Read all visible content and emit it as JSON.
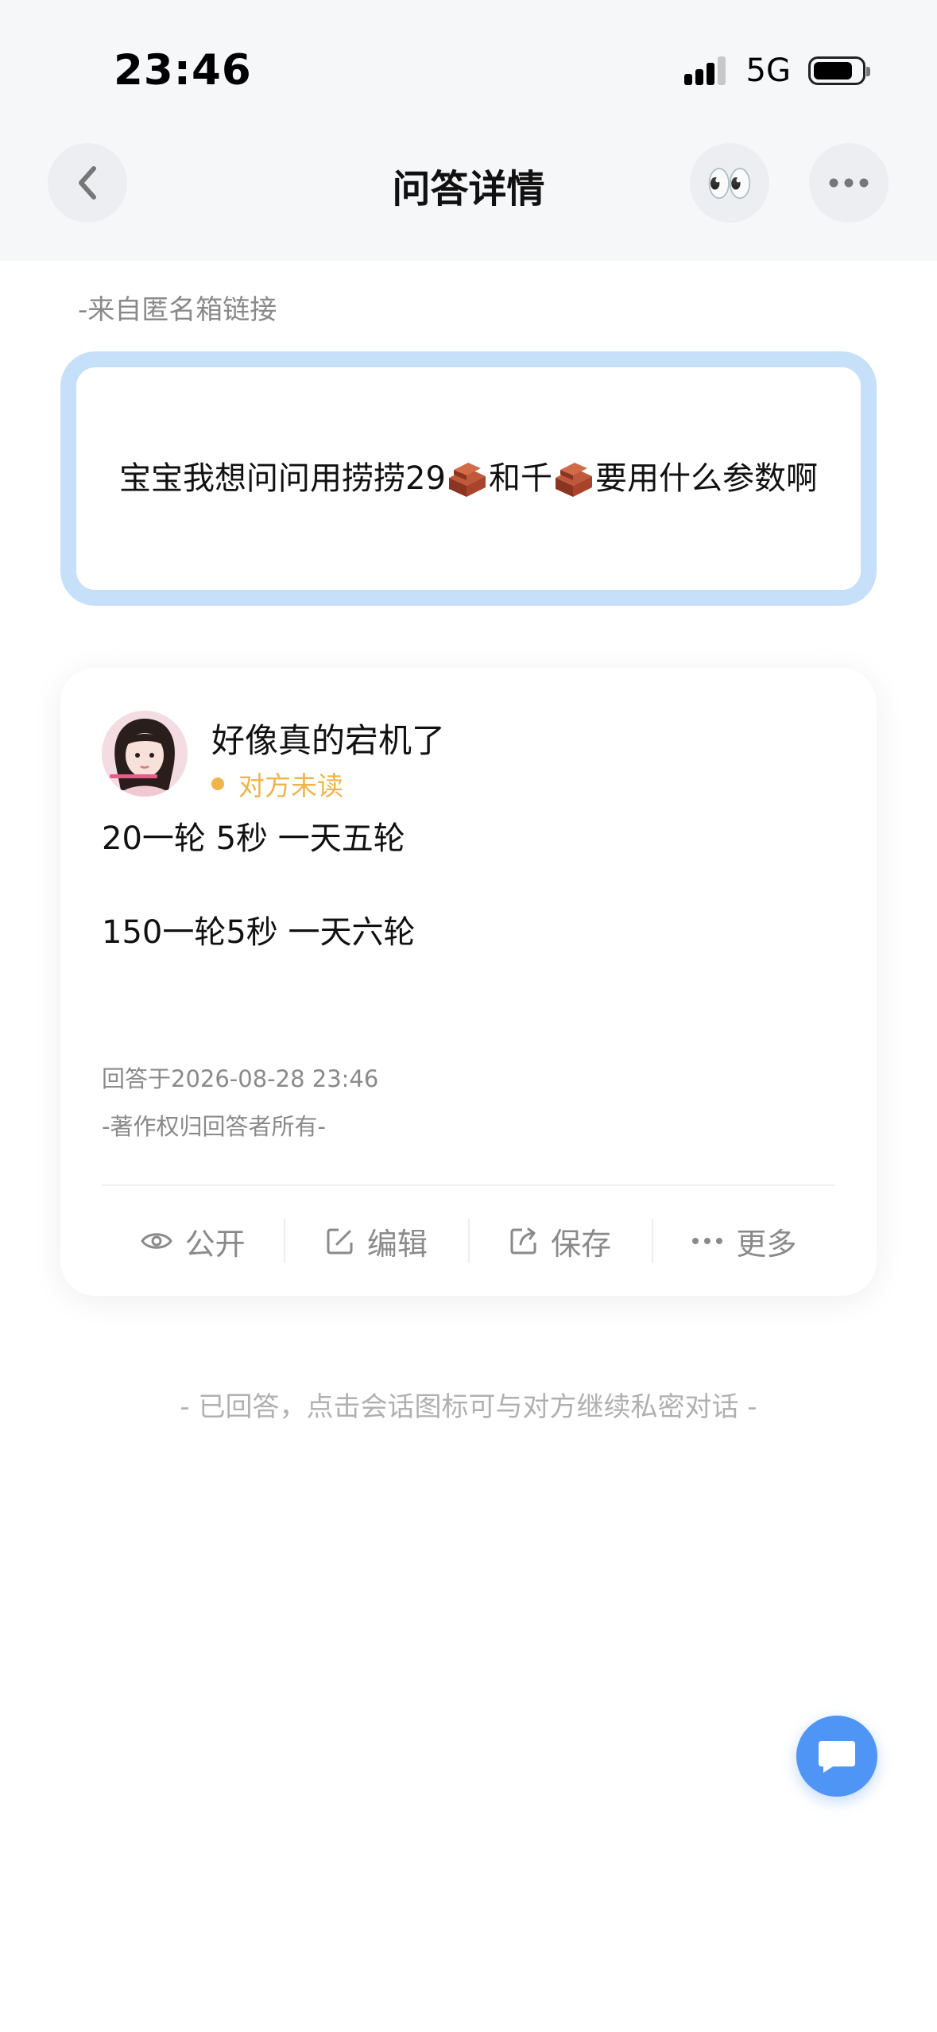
{
  "status_bar": {
    "time": "23:46",
    "carrier": "5G"
  },
  "nav": {
    "title": "问答详情",
    "eyes_emoji": "👀"
  },
  "question": {
    "source": "-来自匿名箱链接",
    "text_part1": "宝宝我想问问用捞捞29",
    "text_part2": "和千",
    "text_part3": "要用什么参数啊"
  },
  "answer": {
    "author": "好像真的宕机了",
    "read_status": "对方未读",
    "line1": "20一轮 5秒 一天五轮",
    "line2": "150一轮5秒 一天六轮",
    "answered_at": "回答于2026-08-28 23:46",
    "copyright": "-著作权归回答者所有-",
    "actions": [
      "公开",
      "编辑",
      "保存",
      "更多"
    ]
  },
  "footer_hint": "- 已回答，点击会话图标可与对方继续私密对话 -",
  "colors": {
    "accent": "#4f95f5",
    "question_border": "#c6e0fa",
    "unread": "#f0b44a"
  }
}
